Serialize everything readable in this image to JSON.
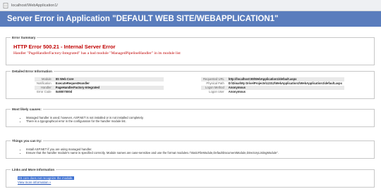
{
  "browser": {
    "url": "localhost/WebApplication1/"
  },
  "page": {
    "title": "Server Error in Application \"DEFAULT WEB SITE/WEBAPPLICATION1\""
  },
  "error_summary": {
    "legend": "Error Summary",
    "title": "HTTP Error 500.21 - Internal Server Error",
    "message": "Handler \"PageHandlerFactory-Integrated\" has a bad module \"ManagedPipelineHandler\" in its module list"
  },
  "detailed_info": {
    "legend": "Detailed Error Information",
    "left_rows": [
      {
        "key": "Module",
        "value": "IIS Web Core"
      },
      {
        "key": "Notification",
        "value": "ExecuteRequestHandler"
      },
      {
        "key": "Handler",
        "value": "PageHandlerFactory-Integrated"
      },
      {
        "key": "Error Code",
        "value": "0x8007000d"
      }
    ],
    "right_rows": [
      {
        "key": "Requested URL",
        "value": "http://localhost:80/WebApplication1/default.aspx"
      },
      {
        "key": "Physical Path",
        "value": "D:\\Dinar\\My Drive\\Projects\\12312\\WebApplication1\\WebApplication1\\default.aspx"
      },
      {
        "key": "Logon Method",
        "value": "Anonymous"
      },
      {
        "key": "Logon User",
        "value": "Anonymous"
      }
    ]
  },
  "causes": {
    "legend": "Most likely causes:",
    "items": [
      "Managed handler is used; however, ASP.NET is not installed or is not installed completely.",
      "There is a typographical error in the configuration for the handler module list."
    ]
  },
  "fixes": {
    "legend": "Things you can try:",
    "items": [
      "Install ASP.NET if you are using managed handler.",
      "Ensure that the handler module's name is specified correctly. Module names are case-sensitive and use the format modules=\"StaticFileModule,DefaultDocumentModule,DirectoryListingModule\"."
    ]
  },
  "links": {
    "legend": "Links and More Information",
    "items": [
      "IIS core does not recognize the module.",
      "View more information »"
    ]
  },
  "colors": {
    "header": "#5a7dbd",
    "error_red": "#c00000",
    "link_blue": "#1f4fb3"
  },
  "icons": [
    "page-icon"
  ]
}
